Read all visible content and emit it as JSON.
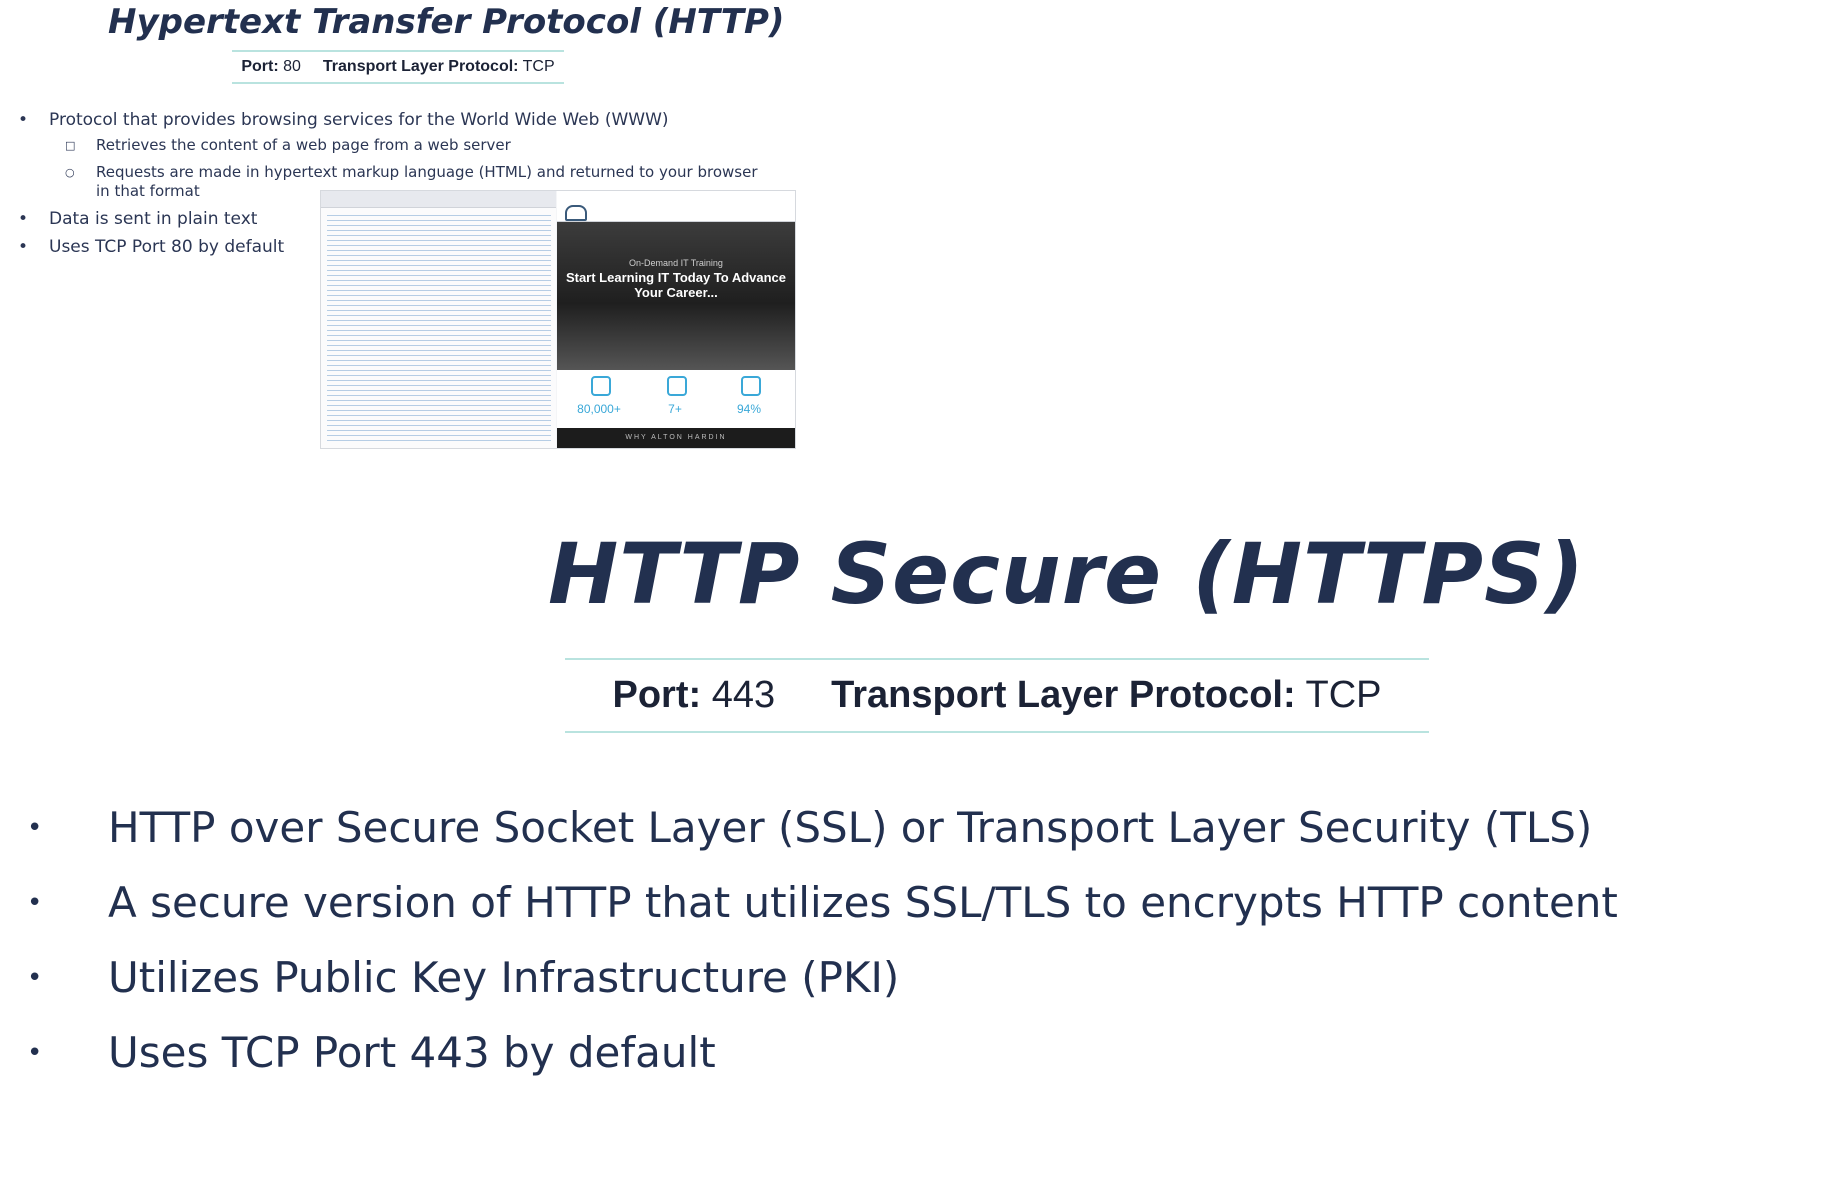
{
  "small_slide": {
    "title": "Hypertext Transfer Protocol (HTTP)",
    "port_label": "Port:",
    "port_value": "80",
    "transport_label": "Transport Layer Protocol:",
    "transport_value": "TCP",
    "bullets": [
      "Protocol that provides browsing services for the World Wide Web (WWW)",
      "Retrieves the content of a web page from a web server",
      "Requests are made in hypertext markup language (HTML) and returned to your browser",
      "in that format",
      "Data is sent in plain text",
      "Uses TCP Port 80 by default"
    ],
    "screenshot": {
      "eyebrow": "On-Demand IT Training",
      "headline": "Start Learning IT Today To Advance Your Career...",
      "stats": [
        "80,000+",
        "7+",
        "94%"
      ],
      "footer": "WHY ALTON HARDIN"
    }
  },
  "main_slide": {
    "title": "HTTP Secure (HTTPS)",
    "port_label": "Port:",
    "port_value": "443",
    "transport_label": "Transport Layer Protocol:",
    "transport_value": "TCP",
    "bullets": [
      "HTTP over Secure Socket Layer (SSL) or Transport Layer Security (TLS)",
      "A secure version of HTTP that utilizes SSL/TLS to encrypts HTTP content",
      "Utilizes Public Key Infrastructure (PKI)",
      "Uses TCP Port 443 by default"
    ]
  },
  "colors": {
    "title": "#22304f",
    "rule": "#b9e3df",
    "stat_accent": "#3aa8d8"
  }
}
